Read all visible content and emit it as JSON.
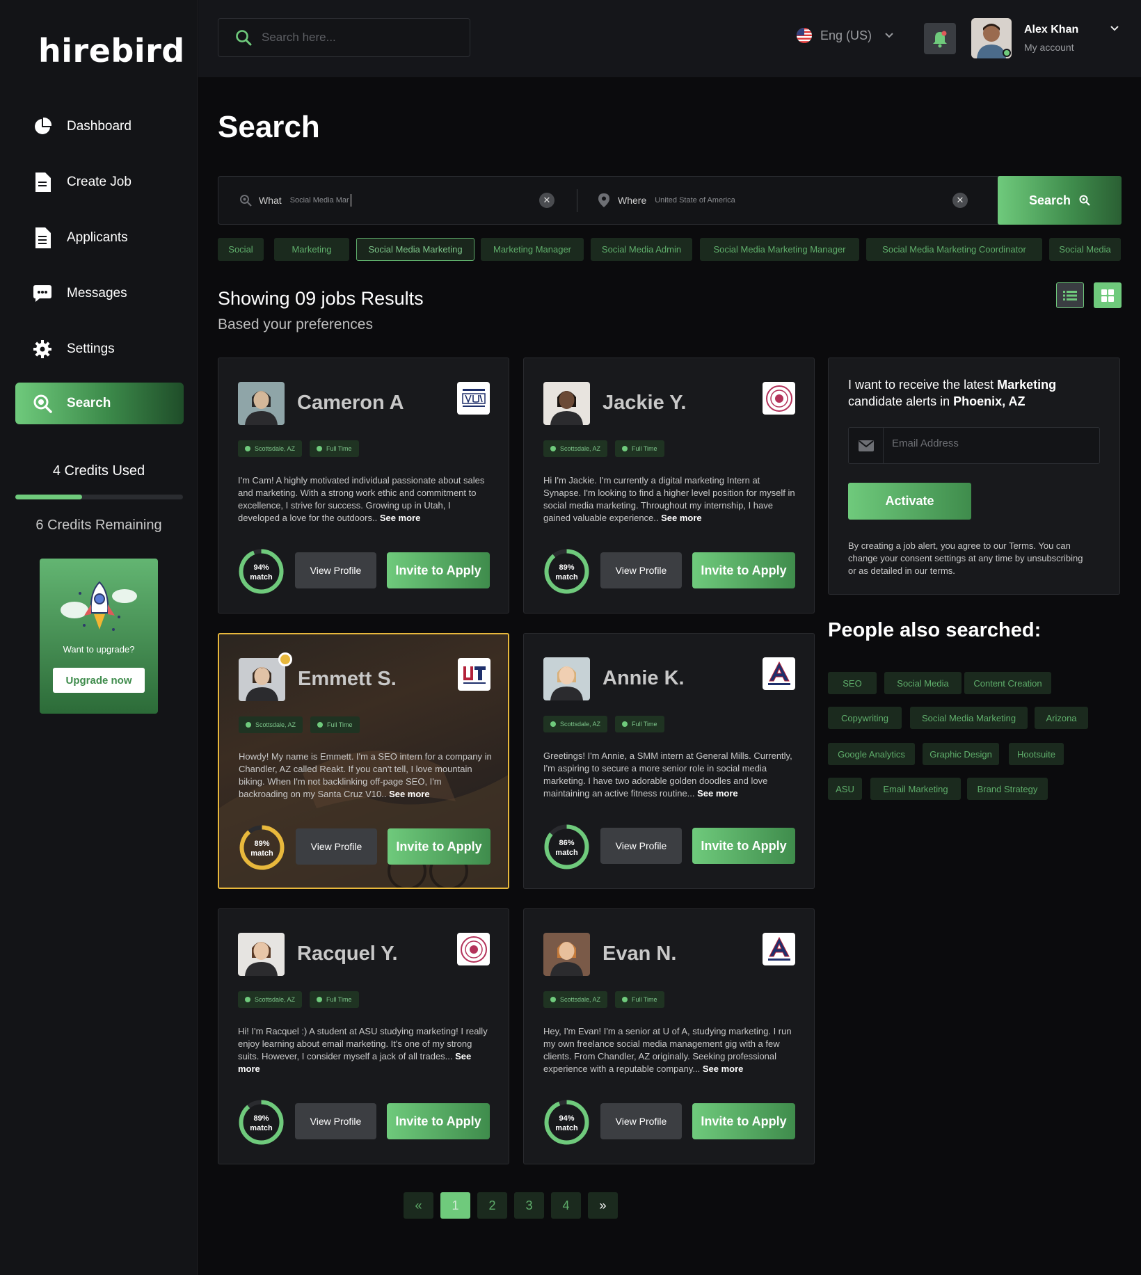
{
  "app": {
    "logo": "hirebird"
  },
  "sidebar": {
    "items": [
      {
        "label": "Dashboard",
        "icon": "pie-chart-icon"
      },
      {
        "label": "Create Job",
        "icon": "document-icon"
      },
      {
        "label": "Applicants",
        "icon": "file-list-icon"
      },
      {
        "label": "Messages",
        "icon": "chat-icon"
      },
      {
        "label": "Settings",
        "icon": "gear-icon"
      },
      {
        "label": "Search",
        "icon": "search-icon",
        "active": true
      }
    ],
    "credits_used": "4 Credits Used",
    "credits_remaining": "6 Credits Remaining",
    "credits_fraction": 0.4,
    "upgrade_text": "Want to upgrade?",
    "upgrade_button": "Upgrade now"
  },
  "topbar": {
    "search_placeholder": "Search here...",
    "language": "Eng (US)",
    "user_name": "Alex Khan",
    "user_sub": "My account"
  },
  "main": {
    "title": "Search",
    "what_label": "What",
    "what_value": "Social Media Mar",
    "where_label": "Where",
    "where_value": "United State of America",
    "search_button": "Search",
    "chips": [
      "Social",
      "Marketing",
      "Social Media Marketing",
      "Marketing Manager",
      "Social Media Admin",
      "Social Media Marketing Manager",
      "Social Media Marketing Coordinator",
      "Social Media"
    ],
    "selected_chip": "Social Media Marketing",
    "results_title": "Showing 09 jobs Results",
    "results_sub": "Based your preferences"
  },
  "cards": [
    {
      "name": "Cameron A",
      "location": "Scottsdale, AZ",
      "type": "Full Time",
      "bio": "I'm Cam! A highly motivated individual passionate about sales and marketing. With a strong work ethic and commitment to excellence, I strive for success. Growing up in Utah, I developed a love for the outdoors.. ",
      "more": "See more",
      "match": "94%",
      "match_label": "match",
      "match_fraction": 0.94
    },
    {
      "name": "Jackie Y.",
      "location": "Scottsdale, AZ",
      "type": "Full Time",
      "bio": "Hi I'm Jackie. I'm currently a digital marketing Intern at Synapse. I'm looking to find a higher level position for myself in social media marketing. Throughout my internship, I have gained valuable experience.. ",
      "more": "See more",
      "match": "89%",
      "match_label": "match",
      "match_fraction": 0.89
    },
    {
      "name": "Emmett S.",
      "location": "Scottsdale, AZ",
      "type": "Full Time",
      "bio": "Howdy! My name is Emmett. I'm a SEO intern for a company in Chandler, AZ called Reakt. If you can't tell, I love mountain biking. When I'm not backlinking off-page SEO, I'm backroading on my Santa Cruz V10.. ",
      "more": "See more",
      "match": "89%",
      "match_label": "match",
      "match_fraction": 0.89,
      "featured": true
    },
    {
      "name": "Annie K.",
      "location": "Scottsdale, AZ",
      "type": "Full Time",
      "bio": "Greetings! I'm Annie, a SMM intern at General Mills. Currently, I'm aspiring to secure a more senior role in social media marketing. I have two adorable golden doodles and love maintaining an active fitness routine... ",
      "more": "See more",
      "match": "86%",
      "match_label": "match",
      "match_fraction": 0.86
    },
    {
      "name": "Racquel Y.",
      "location": "Scottsdale, AZ",
      "type": "Full Time",
      "bio": "Hi! I'm Racquel :) A student at ASU studying marketing! I really enjoy learning about email marketing. It's one of my strong suits. However, I consider myself a jack of all trades... ",
      "more": "See more",
      "match": "89%",
      "match_label": "match",
      "match_fraction": 0.89
    },
    {
      "name": "Evan N.",
      "location": "Scottsdale, AZ",
      "type": "Full Time",
      "bio": "Hey, I'm Evan! I'm a senior at U of A, studying marketing. I run my own freelance social media management gig with a few clients. From Chandler, AZ originally. Seeking professional experience with a reputable company... ",
      "more": "See more",
      "match": "94%",
      "match_label": "match",
      "match_fraction": 0.94
    }
  ],
  "card_actions": {
    "view": "View Profile",
    "invite": "Invite to Apply"
  },
  "alert": {
    "text_pre": "I want to receive the latest ",
    "keyword": "Marketing",
    "text_mid": " candidate alerts in ",
    "place": "Phoenix, AZ",
    "email_placeholder": "Email Address",
    "activate": "Activate",
    "terms": "By creating a job alert, you agree to our Terms. You can change your consent settings at any time by unsubscribing or as detailed in our terms."
  },
  "also_searched": {
    "title": "People also searched:",
    "rows": [
      [
        "SEO",
        "Social Media",
        "Content Creation"
      ],
      [
        "Copywriting",
        "Social Media Marketing",
        "Arizona"
      ],
      [
        "Google Analytics",
        "Graphic Design",
        "Hootsuite"
      ],
      [
        "ASU",
        "Email Marketing",
        "Brand Strategy"
      ]
    ]
  },
  "pagination": {
    "prev": "«",
    "pages": [
      "1",
      "2",
      "3",
      "4"
    ],
    "next": "»",
    "current": "1"
  },
  "colors": {
    "accent": "#6fca7c",
    "accent_dark": "#3f8c4c",
    "featured": "#e8b83c",
    "bg": "#0b0b0d"
  }
}
